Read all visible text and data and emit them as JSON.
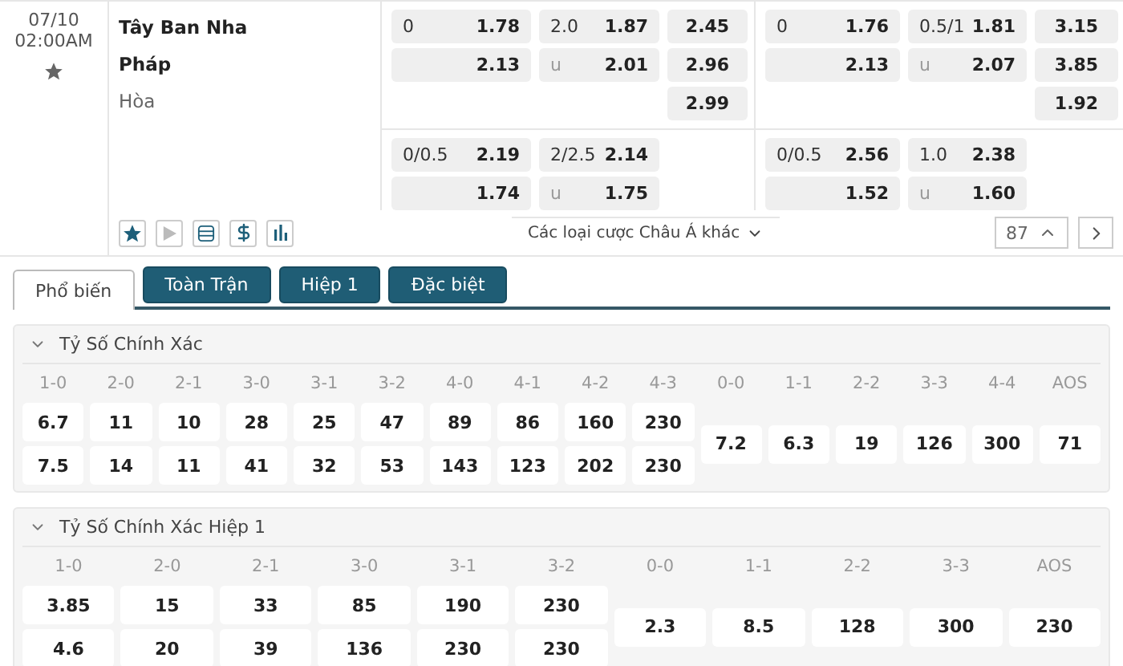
{
  "match": {
    "date": "07/10",
    "time": "02:00AM",
    "favorite": false,
    "teams": [
      {
        "name": "Tây Ban Nha",
        "kind": "team"
      },
      {
        "name": "Pháp",
        "kind": "team"
      },
      {
        "name": "Hòa",
        "kind": "draw"
      }
    ]
  },
  "markets": [
    {
      "blocks": [
        {
          "rows": [
            {
              "handicap": {
                "line": "0",
                "odds": "1.78"
              },
              "over_under": {
                "line": "2.0",
                "odds": "1.87"
              },
              "result": "2.45"
            },
            {
              "handicap": {
                "odds": "2.13"
              },
              "over_under": {
                "line": "u",
                "odds": "2.01"
              },
              "result": "2.96"
            },
            {
              "result": "2.99"
            }
          ]
        },
        {
          "rows": [
            {
              "handicap": {
                "line": "0/0.5",
                "odds": "2.19"
              },
              "over_under": {
                "line": "2/2.5",
                "odds": "2.14"
              }
            },
            {
              "handicap": {
                "odds": "1.74"
              },
              "over_under": {
                "line": "u",
                "odds": "1.75"
              }
            }
          ]
        }
      ]
    },
    {
      "blocks": [
        {
          "rows": [
            {
              "handicap": {
                "line": "0",
                "odds": "1.76"
              },
              "over_under": {
                "line": "0.5/1",
                "odds": "1.81"
              },
              "result": "3.15"
            },
            {
              "handicap": {
                "odds": "2.13"
              },
              "over_under": {
                "line": "u",
                "odds": "2.07"
              },
              "result": "3.85"
            },
            {
              "result": "1.92"
            }
          ]
        },
        {
          "rows": [
            {
              "handicap": {
                "line": "0/0.5",
                "odds": "2.56"
              },
              "over_under": {
                "line": "1.0",
                "odds": "2.38"
              }
            },
            {
              "handicap": {
                "odds": "1.52"
              },
              "over_under": {
                "line": "u",
                "odds": "1.60"
              }
            }
          ]
        }
      ]
    }
  ],
  "tools": [
    {
      "kind": "favorite",
      "disabled": false
    },
    {
      "kind": "play",
      "disabled": true
    },
    {
      "kind": "list",
      "disabled": false
    },
    {
      "kind": "money",
      "disabled": false
    },
    {
      "kind": "stats",
      "disabled": false
    }
  ],
  "more_markets": "Các loại cược Châu Á khác",
  "market_count": "87",
  "tabs": [
    {
      "label": "Phổ biến",
      "selected": true
    },
    {
      "label": "Toàn Trận",
      "selected": false
    },
    {
      "label": "Hiệp 1",
      "selected": false
    },
    {
      "label": "Đặc biệt",
      "selected": false
    }
  ],
  "sections": [
    {
      "title": "Tỷ Số Chính Xác",
      "expanded": true,
      "columns": [
        {
          "label": "1-0",
          "values": [
            "6.7",
            "7.5"
          ]
        },
        {
          "label": "2-0",
          "values": [
            "11",
            "14"
          ]
        },
        {
          "label": "2-1",
          "values": [
            "10",
            "11"
          ]
        },
        {
          "label": "3-0",
          "values": [
            "28",
            "41"
          ]
        },
        {
          "label": "3-1",
          "values": [
            "25",
            "32"
          ]
        },
        {
          "label": "3-2",
          "values": [
            "47",
            "53"
          ]
        },
        {
          "label": "4-0",
          "values": [
            "89",
            "143"
          ]
        },
        {
          "label": "4-1",
          "values": [
            "86",
            "123"
          ]
        },
        {
          "label": "4-2",
          "values": [
            "160",
            "202"
          ]
        },
        {
          "label": "4-3",
          "values": [
            "230",
            "230"
          ]
        },
        {
          "label": "0-0",
          "values": [
            "7.2"
          ]
        },
        {
          "label": "1-1",
          "values": [
            "6.3"
          ]
        },
        {
          "label": "2-2",
          "values": [
            "19"
          ]
        },
        {
          "label": "3-3",
          "values": [
            "126"
          ]
        },
        {
          "label": "4-4",
          "values": [
            "300"
          ]
        },
        {
          "label": "AOS",
          "values": [
            "71"
          ]
        }
      ]
    },
    {
      "title": "Tỷ Số Chính Xác Hiệp 1",
      "expanded": true,
      "columns": [
        {
          "label": "1-0",
          "values": [
            "3.85",
            "4.6"
          ]
        },
        {
          "label": "2-0",
          "values": [
            "15",
            "20"
          ]
        },
        {
          "label": "2-1",
          "values": [
            "33",
            "39"
          ]
        },
        {
          "label": "3-0",
          "values": [
            "85",
            "136"
          ]
        },
        {
          "label": "3-1",
          "values": [
            "190",
            "230"
          ]
        },
        {
          "label": "3-2",
          "values": [
            "230",
            "230"
          ]
        },
        {
          "label": "0-0",
          "values": [
            "2.3"
          ]
        },
        {
          "label": "1-1",
          "values": [
            "8.5"
          ]
        },
        {
          "label": "2-2",
          "values": [
            "128"
          ]
        },
        {
          "label": "3-3",
          "values": [
            "300"
          ]
        },
        {
          "label": "AOS",
          "values": [
            "230"
          ]
        }
      ]
    }
  ]
}
